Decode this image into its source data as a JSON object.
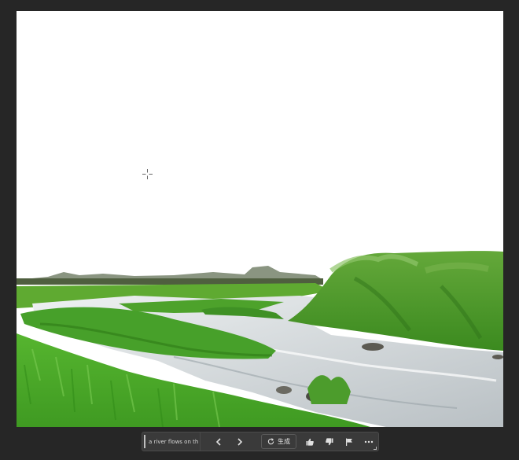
{
  "canvas": {
    "image_icon": "river-landscape-image",
    "cursor_icon": "crosshair-icon"
  },
  "taskbar": {
    "prompt_value": "a river flows on th",
    "prev_icon": "chevron-left-icon",
    "next_icon": "chevron-right-icon",
    "generate_label": "生成",
    "generate_icon": "refresh-icon",
    "thumbs_up_icon": "thumbs-up-icon",
    "thumbs_down_icon": "thumbs-down-icon",
    "flag_icon": "flag-icon",
    "more_icon": "more-horizontal-icon"
  },
  "colors": {
    "background": "#262626",
    "taskbar_bg": "#3a3a3a",
    "sky": "#ffffff",
    "grass": "#4caf2a",
    "water": "#dfe3e6"
  }
}
